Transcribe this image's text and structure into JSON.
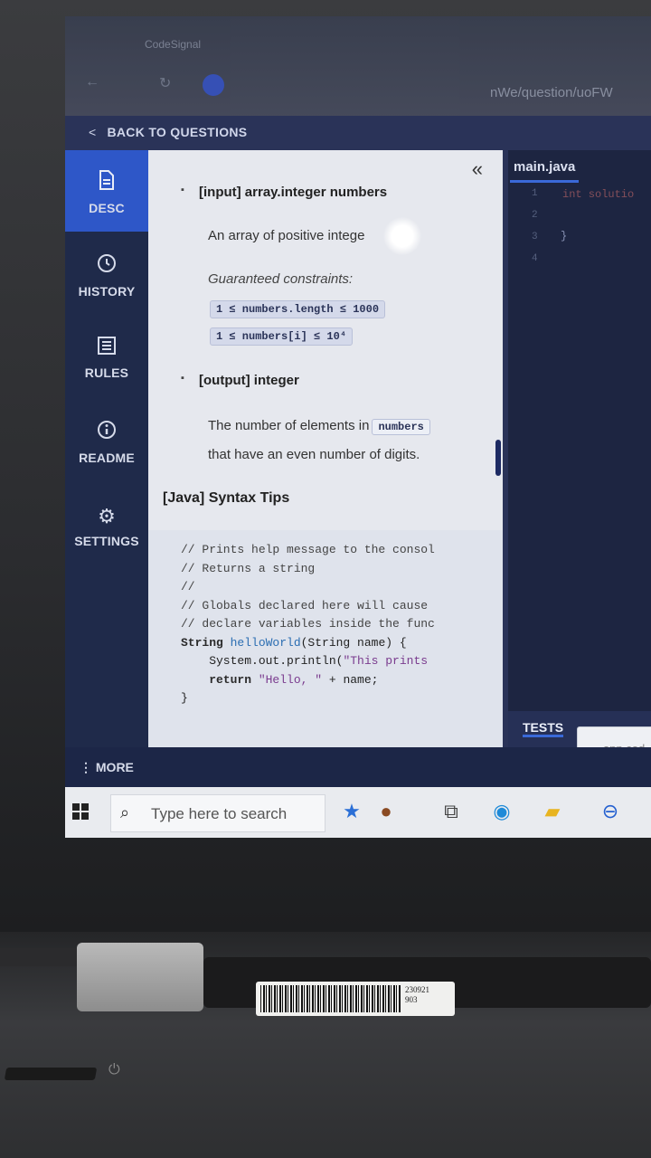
{
  "browser": {
    "tab_title": "CodeSignal",
    "url_tail": "nWe/question/uoFW"
  },
  "header": {
    "back_label": "BACK TO QUESTIONS"
  },
  "sidebar": {
    "items": [
      {
        "label": "DESC",
        "icon": "document-icon"
      },
      {
        "label": "HISTORY",
        "icon": "clock-icon"
      },
      {
        "label": "RULES",
        "icon": "list-icon"
      },
      {
        "label": "README",
        "icon": "info-icon"
      },
      {
        "label": "SETTINGS",
        "icon": "gear-icon"
      }
    ]
  },
  "description": {
    "input_title": "[input] array.integer numbers",
    "input_desc": "An array of positive intege",
    "constraints_label": "Guaranteed constraints:",
    "constraint_1": "1 ≤ numbers.length ≤ 1000",
    "constraint_2": "1 ≤ numbers[i] ≤ 10⁴",
    "output_title": "[output] integer",
    "output_desc_prefix": "The number of elements in",
    "output_desc_chip": "numbers",
    "output_desc_suffix": "that have an even number of digits.",
    "syntax_title": "[Java] Syntax Tips"
  },
  "code_tips": {
    "line1": "// Prints help message to the consol",
    "line2": "// Returns a string",
    "line3": "//",
    "line4": "// Globals declared here will cause",
    "line5": "// declare variables inside the func",
    "line6_kw": "String ",
    "line6_fn": "helloWorld",
    "line6_rest": "(String name) {",
    "line7_a": "    System.out.println(",
    "line7_str": "\"This prints",
    "line8_a": "    return ",
    "line8_str": "\"Hello, \"",
    "line8_b": " + name;",
    "line9": "}"
  },
  "editor": {
    "file_tab": "main.java",
    "line_numbers": [
      "1",
      "2",
      "3",
      "4"
    ],
    "code_peek": "int solutio",
    "brace": "}",
    "tests_tab": "TESTS",
    "toast_text": "app.cod"
  },
  "more_bar": {
    "label": "⋮ MORE"
  },
  "taskbar": {
    "search_placeholder": "Type here to search"
  },
  "sticker": {
    "code": "230921\n903"
  }
}
